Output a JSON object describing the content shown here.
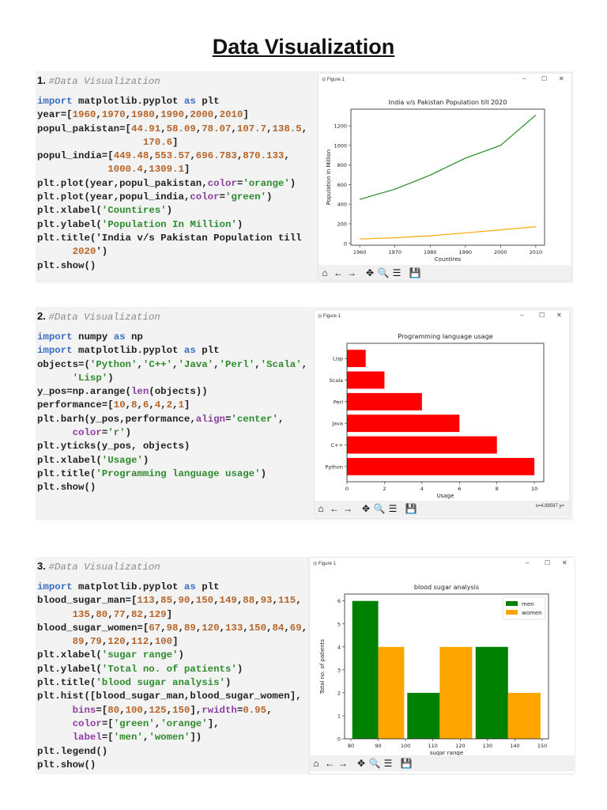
{
  "doc": {
    "title": "Data Visualization"
  },
  "sections": [
    {
      "number": "1.",
      "comment": "#Data Visualization",
      "code": [
        "import matplotlib.pyplot as plt",
        "year=[1960,1970,1980,1990,2000,2010]",
        "popul_pakistan=[44.91,58.09,78.07,107.7,138.5,",
        "                  170.6]",
        "popul_india=[449.48,553.57,696.783,870.133,",
        "            1000.4,1309.1]",
        "plt.plot(year,popul_pakistan,color='orange')",
        "plt.plot(year,popul_india,color='green')",
        "plt.xlabel('Countires')",
        "plt.ylabel('Population In Million')",
        "plt.title('India v/s Pakistan Population till",
        "      2020')",
        "plt.show()"
      ]
    },
    {
      "number": "2.",
      "comment": "#Data Visualization",
      "code": [
        "import numpy as np",
        "import matplotlib.pyplot as plt",
        "objects=('Python','C++','Java','Perl','Scala',",
        "      'Lisp')",
        "y_pos=np.arange(len(objects))",
        "performance=[10,8,6,4,2,1]",
        "plt.barh(y_pos,performance,align='center',",
        "      color='r')",
        "plt.yticks(y_pos, objects)",
        "plt.xlabel('Usage')",
        "plt.title('Programming language usage')",
        "plt.show()"
      ]
    },
    {
      "number": "3.",
      "comment": "#Data Visualization",
      "code": [
        "import matplotlib.pyplot as plt",
        "blood_sugar_man=[113,85,90,150,149,88,93,115,",
        "      135,80,77,82,129]",
        "blood_sugar_women=[67,98,89,120,133,150,84,69,",
        "      89,79,120,112,100]",
        "plt.xlabel('sugar range')",
        "plt.ylabel('Total no. of patients')",
        "plt.title('blood sugar analysis')",
        "plt.hist([blood_sugar_man,blood_sugar_women],",
        "      bins=[80,100,125,150],rwidth=0.95,",
        "      color=['green','orange'],",
        "      label=['men','women'])",
        "plt.legend()",
        "plt.show()"
      ]
    }
  ],
  "window": {
    "title": "Figure 1",
    "min": "–",
    "max": "☐",
    "close": "✕",
    "toolbar": [
      "⌂",
      "←",
      "→",
      "✥",
      "🔍",
      "☰",
      "💾"
    ]
  },
  "status2": "x=4.99597    y=",
  "chart_data": [
    {
      "type": "line",
      "title": "India v/s Pakistan Population till 2020",
      "xlabel": "Countires",
      "ylabel": "Population In Million",
      "x": [
        1960,
        1970,
        1980,
        1990,
        2000,
        2010
      ],
      "series": [
        {
          "name": "Pakistan",
          "color": "#ffa500",
          "values": [
            44.91,
            58.09,
            78.07,
            107.7,
            138.5,
            170.6
          ]
        },
        {
          "name": "India",
          "color": "#228b22",
          "values": [
            449.48,
            553.57,
            696.783,
            870.133,
            1000.4,
            1309.1
          ]
        }
      ],
      "xlim": [
        1957.5,
        2012.5
      ],
      "ylim": [
        -18,
        1370
      ],
      "xticks": [
        1960,
        1970,
        1980,
        1990,
        2000,
        2010
      ],
      "yticks": [
        0,
        200,
        400,
        600,
        800,
        1000,
        1200
      ]
    },
    {
      "type": "bar",
      "orientation": "horizontal",
      "title": "Programming language usage",
      "xlabel": "Usage",
      "ylabel": "",
      "categories": [
        "Python",
        "C++",
        "Java",
        "Perl",
        "Scala",
        "Lisp"
      ],
      "values": [
        10,
        8,
        6,
        4,
        2,
        1
      ],
      "color": "#ff0000",
      "xlim": [
        0,
        10.5
      ],
      "xticks": [
        0,
        2,
        4,
        6,
        8,
        10
      ]
    },
    {
      "type": "bar",
      "subtype": "histogram",
      "title": "blood sugar analysis",
      "xlabel": "sugar range",
      "ylabel": "Total no. of patients",
      "bins": [
        80,
        100,
        125,
        150
      ],
      "series": [
        {
          "name": "men",
          "color": "#008000",
          "values": [
            6,
            2,
            4
          ]
        },
        {
          "name": "women",
          "color": "#ffa500",
          "values": [
            4,
            4,
            2
          ]
        }
      ],
      "xlim": [
        77.7,
        152.3
      ],
      "ylim": [
        0,
        6.3
      ],
      "xticks": [
        80,
        90,
        100,
        110,
        120,
        130,
        140,
        150
      ],
      "yticks": [
        0,
        1,
        2,
        3,
        4,
        5,
        6
      ],
      "legend": "top-right"
    }
  ]
}
